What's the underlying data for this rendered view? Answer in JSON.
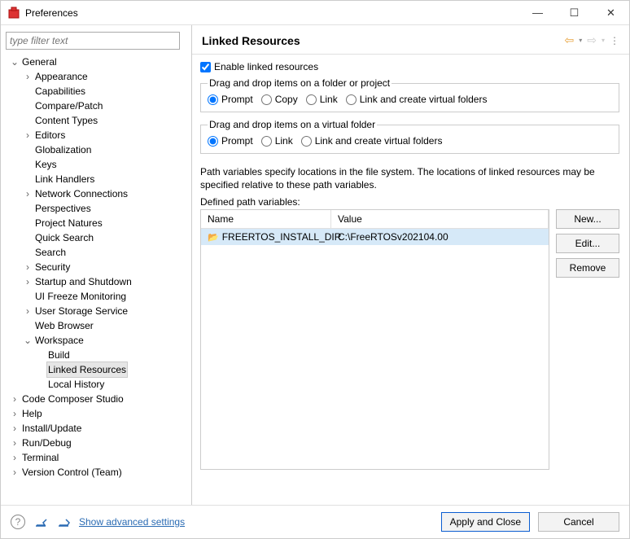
{
  "window": {
    "title": "Preferences"
  },
  "filter_placeholder": "type filter text",
  "tree": [
    {
      "label": "General",
      "depth": 0,
      "tw": "v"
    },
    {
      "label": "Appearance",
      "depth": 1,
      "tw": ">"
    },
    {
      "label": "Capabilities",
      "depth": 1,
      "tw": ""
    },
    {
      "label": "Compare/Patch",
      "depth": 1,
      "tw": ""
    },
    {
      "label": "Content Types",
      "depth": 1,
      "tw": ""
    },
    {
      "label": "Editors",
      "depth": 1,
      "tw": ">"
    },
    {
      "label": "Globalization",
      "depth": 1,
      "tw": ""
    },
    {
      "label": "Keys",
      "depth": 1,
      "tw": ""
    },
    {
      "label": "Link Handlers",
      "depth": 1,
      "tw": ""
    },
    {
      "label": "Network Connections",
      "depth": 1,
      "tw": ">"
    },
    {
      "label": "Perspectives",
      "depth": 1,
      "tw": ""
    },
    {
      "label": "Project Natures",
      "depth": 1,
      "tw": ""
    },
    {
      "label": "Quick Search",
      "depth": 1,
      "tw": ""
    },
    {
      "label": "Search",
      "depth": 1,
      "tw": ""
    },
    {
      "label": "Security",
      "depth": 1,
      "tw": ">"
    },
    {
      "label": "Startup and Shutdown",
      "depth": 1,
      "tw": ">"
    },
    {
      "label": "UI Freeze Monitoring",
      "depth": 1,
      "tw": ""
    },
    {
      "label": "User Storage Service",
      "depth": 1,
      "tw": ">"
    },
    {
      "label": "Web Browser",
      "depth": 1,
      "tw": ""
    },
    {
      "label": "Workspace",
      "depth": 1,
      "tw": "v"
    },
    {
      "label": "Build",
      "depth": 2,
      "tw": ""
    },
    {
      "label": "Linked Resources",
      "depth": 2,
      "tw": "",
      "selected": true
    },
    {
      "label": "Local History",
      "depth": 2,
      "tw": ""
    },
    {
      "label": "Code Composer Studio",
      "depth": 0,
      "tw": ">"
    },
    {
      "label": "Help",
      "depth": 0,
      "tw": ">"
    },
    {
      "label": "Install/Update",
      "depth": 0,
      "tw": ">"
    },
    {
      "label": "Run/Debug",
      "depth": 0,
      "tw": ">"
    },
    {
      "label": "Terminal",
      "depth": 0,
      "tw": ">"
    },
    {
      "label": "Version Control (Team)",
      "depth": 0,
      "tw": ">"
    }
  ],
  "page": {
    "title": "Linked Resources",
    "enable_label": "Enable linked resources",
    "enable_checked": true,
    "group1": {
      "legend": "Drag and drop items on a folder or project",
      "options": [
        "Prompt",
        "Copy",
        "Link",
        "Link and create virtual folders"
      ],
      "selected": 0
    },
    "group2": {
      "legend": "Drag and drop items on a virtual folder",
      "options": [
        "Prompt",
        "Link",
        "Link and create virtual folders"
      ],
      "selected": 0
    },
    "description": "Path variables specify locations in the file system. The locations of linked resources may be specified relative to these path variables.",
    "defined_label": "Defined path variables:",
    "table": {
      "headers": {
        "name": "Name",
        "value": "Value"
      },
      "rows": [
        {
          "name": "FREERTOS_INSTALL_DIR",
          "value": "C:\\FreeRTOSv202104.00",
          "selected": true
        }
      ]
    },
    "buttons": {
      "new": "New...",
      "edit": "Edit...",
      "remove": "Remove"
    }
  },
  "footer": {
    "advanced": "Show advanced settings",
    "apply": "Apply and Close",
    "cancel": "Cancel"
  }
}
